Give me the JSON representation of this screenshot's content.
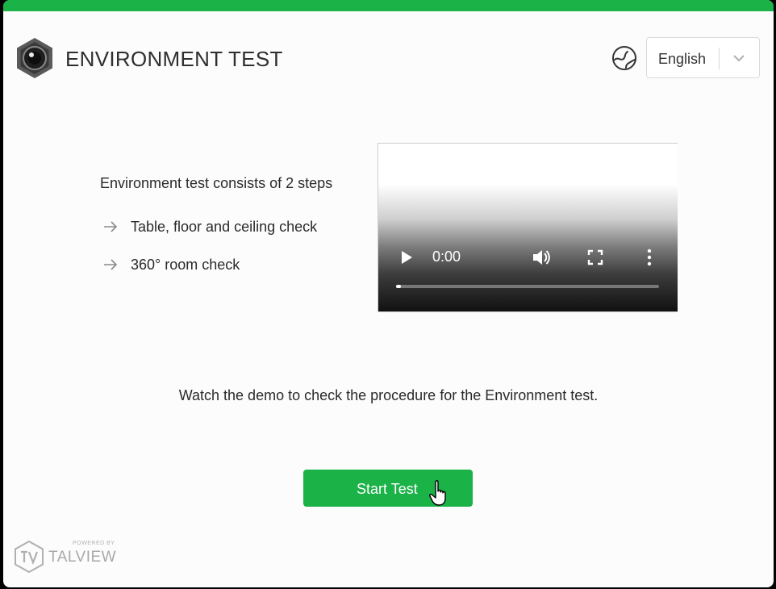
{
  "header": {
    "title": "ENVIRONMENT TEST",
    "logo_icon": "camera-lens-hexagon-icon",
    "globe_icon": "globe-icon",
    "language_value": "English",
    "chevron_icon": "chevron-down-icon"
  },
  "intro": {
    "title": "Environment test consists of 2 steps",
    "steps": [
      {
        "label": "Table, floor and ceiling check",
        "icon": "arrow-right-icon"
      },
      {
        "label": "360° room check",
        "icon": "arrow-right-icon"
      }
    ]
  },
  "video": {
    "time": "0:00",
    "progress": 0.0,
    "controls": [
      "play-icon",
      "volume-icon",
      "fullscreen-icon",
      "more-options-icon"
    ]
  },
  "instruction": "Watch the demo to check the procedure for the Environment test.",
  "actions": {
    "start_label": "Start Test"
  },
  "footer": {
    "powered_by": "POWERED BY",
    "brand": "TALVIEW"
  },
  "colors": {
    "accent": "#1bb248",
    "text": "#2a2a2a",
    "muted": "#a9a9a9"
  }
}
